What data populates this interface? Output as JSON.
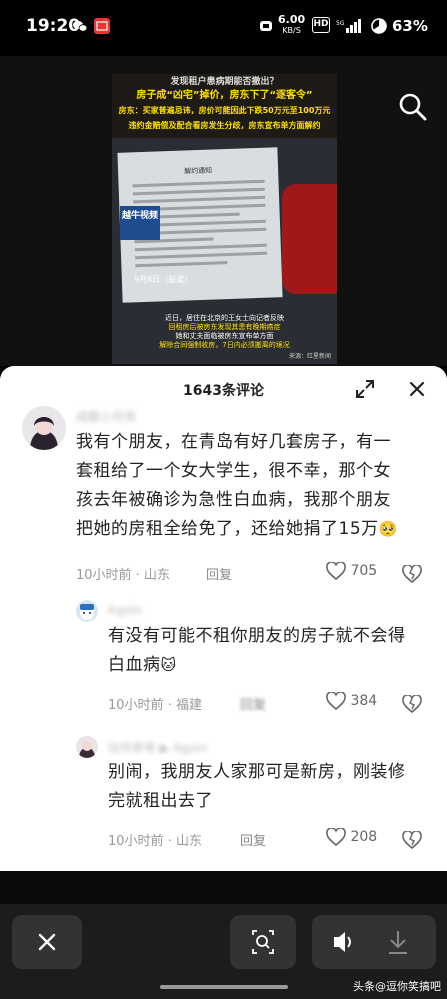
{
  "status_bar": {
    "time": "19:20",
    "net_speed": "6.00",
    "net_unit": "KB/S",
    "hd": "HD",
    "battery": "63%"
  },
  "video": {
    "headline_top": "发现租户患病期能否撤出？",
    "headline_1": "房子成“凶宅”掉价，房东下了“逐客令”",
    "headline_2": "房东：买家普遍忌讳，房价可能因此下跌50万元至100万元",
    "headline_3": "违约金赔偿及配合看房发生分歧，房东宣布单方面解约",
    "doc_title": "解约通知",
    "badge": "越牛视频",
    "date_label": "9月8日（报道）",
    "subtitle_1": "近日，居住在北京的王女士向记者反映",
    "subtitle_2": "回租房后被房东发现其患有晚期癌症",
    "subtitle_3": "她和丈夫面临被房东宣布单方面",
    "subtitle_4": "解除合同强制收房，7日内必须搬离的境况",
    "source": "来源：红星新闻"
  },
  "panel": {
    "title": "1643条评论"
  },
  "comments": [
    {
      "username": "成都小月亮",
      "text_lines": [
        "我有个朋友，在青岛有好几套房子，有一",
        "套租给了一个女大学生，很不幸，那个女",
        "孩去年被确诊为急性白血病，我那个朋友",
        "把她的房租全给免了，还给她捐了15万"
      ],
      "emoji": "🥺",
      "meta": "10小时前 · 山东",
      "reply": "回复",
      "likes": "705"
    },
    {
      "username": "Agoin",
      "text_lines": [
        "有没有可能不租你朋友的房子就不会得",
        "白血病"
      ],
      "emoji": "🐱",
      "meta": "10小时前 · 福建",
      "reply": "回复",
      "likes": "384"
    },
    {
      "username": "仅作参考 ▶ Agoin",
      "text_lines": [
        "别闹，我朋友人家那可是新房，刚装修",
        "完就租出去了"
      ],
      "emoji": "",
      "meta": "10小时前 · 山东",
      "reply": "回复",
      "likes": "208"
    }
  ],
  "watermark": "头条@逗你笑搞吧",
  "colors": {
    "accent_yellow": "#ffe000",
    "panel_bg": "#ffffff",
    "toolbar_bg": "#1c1c1c"
  }
}
